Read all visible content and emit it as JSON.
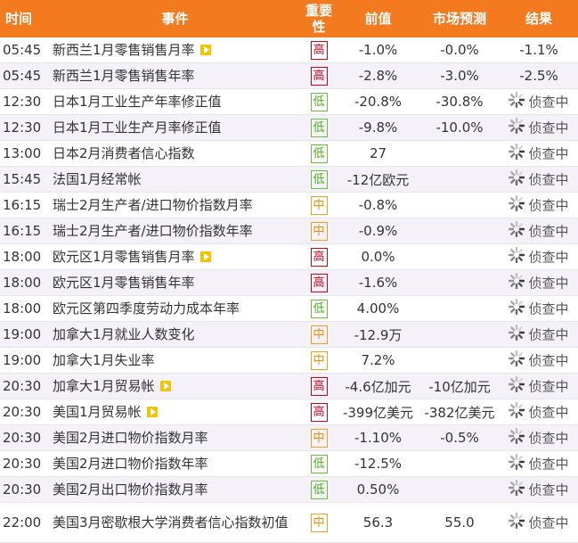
{
  "header": {
    "time": "时间",
    "event": "事件",
    "importance": "重要性",
    "previous": "前值",
    "forecast": "市场预测",
    "result": "结果"
  },
  "rows": [
    {
      "time": "05:45",
      "event": "新西兰1月零售销售月率",
      "video": true,
      "importance": "高",
      "level": "high",
      "previous": "-1.0%",
      "forecast": "-0.0%",
      "result": "-1.1%",
      "pending": false
    },
    {
      "time": "05:45",
      "event": "新西兰1月零售销售年率",
      "video": false,
      "importance": "高",
      "level": "high",
      "previous": "-2.8%",
      "forecast": "-3.0%",
      "result": "-2.5%",
      "pending": false
    },
    {
      "time": "12:30",
      "event": "日本1月工业生产年率修正值",
      "video": false,
      "importance": "低",
      "level": "low",
      "previous": "-20.8%",
      "forecast": "-30.8%",
      "result": "侦查中",
      "pending": true
    },
    {
      "time": "12:30",
      "event": "日本1月工业生产月率修正值",
      "video": false,
      "importance": "低",
      "level": "low",
      "previous": "-9.8%",
      "forecast": "-10.0%",
      "result": "侦查中",
      "pending": true
    },
    {
      "time": "13:00",
      "event": "日本2月消费者信心指数",
      "video": false,
      "importance": "低",
      "level": "low",
      "previous": "27",
      "forecast": "",
      "result": "侦查中",
      "pending": true
    },
    {
      "time": "15:45",
      "event": "法国1月经常帐",
      "video": false,
      "importance": "低",
      "level": "low",
      "previous": "-12亿欧元",
      "forecast": "",
      "result": "侦查中",
      "pending": true
    },
    {
      "time": "16:15",
      "event": "瑞士2月生产者/进口物价指数月率",
      "video": false,
      "importance": "中",
      "level": "mid",
      "previous": "-0.8%",
      "forecast": "",
      "result": "侦查中",
      "pending": true
    },
    {
      "time": "16:15",
      "event": "瑞士2月生产者/进口物价指数年率",
      "video": false,
      "importance": "中",
      "level": "mid",
      "previous": "-0.9%",
      "forecast": "",
      "result": "侦查中",
      "pending": true
    },
    {
      "time": "18:00",
      "event": "欧元区1月零售销售月率",
      "video": true,
      "importance": "高",
      "level": "high",
      "previous": "0.0%",
      "forecast": "",
      "result": "侦查中",
      "pending": true
    },
    {
      "time": "18:00",
      "event": "欧元区1月零售销售年率",
      "video": false,
      "importance": "高",
      "level": "high",
      "previous": "-1.6%",
      "forecast": "",
      "result": "侦查中",
      "pending": true
    },
    {
      "time": "18:00",
      "event": "欧元区第四季度劳动力成本年率",
      "video": false,
      "importance": "低",
      "level": "low",
      "previous": "4.00%",
      "forecast": "",
      "result": "侦查中",
      "pending": true
    },
    {
      "time": "19:00",
      "event": "加拿大1月就业人数变化",
      "video": false,
      "importance": "中",
      "level": "mid",
      "previous": "-12.9万",
      "forecast": "",
      "result": "侦查中",
      "pending": true
    },
    {
      "time": "19:00",
      "event": "加拿大1月失业率",
      "video": false,
      "importance": "中",
      "level": "mid",
      "previous": "7.2%",
      "forecast": "",
      "result": "侦查中",
      "pending": true
    },
    {
      "time": "20:30",
      "event": "加拿大1月贸易帐",
      "video": true,
      "importance": "高",
      "level": "high",
      "previous": "-4.6亿加元",
      "forecast": "-10亿加元",
      "result": "侦查中",
      "pending": true
    },
    {
      "time": "20:30",
      "event": "美国1月贸易帐",
      "video": true,
      "importance": "高",
      "level": "high",
      "previous": "-399亿美元",
      "forecast": "-382亿美元",
      "result": "侦查中",
      "pending": true
    },
    {
      "time": "20:30",
      "event": "美国2月进口物价指数月率",
      "video": false,
      "importance": "中",
      "level": "mid",
      "previous": "-1.10%",
      "forecast": "-0.5%",
      "result": "侦查中",
      "pending": true
    },
    {
      "time": "20:30",
      "event": "美国2月进口物价指数年率",
      "video": false,
      "importance": "低",
      "level": "low",
      "previous": "-12.5%",
      "forecast": "",
      "result": "侦查中",
      "pending": true
    },
    {
      "time": "20:30",
      "event": "美国2月出口物价指数月率",
      "video": false,
      "importance": "低",
      "level": "low",
      "previous": "0.50%",
      "forecast": "",
      "result": "侦查中",
      "pending": true
    },
    {
      "time": "22:00",
      "event": "美国3月密歇根大学消费者信心指数初值",
      "video": false,
      "importance": "中",
      "level": "mid",
      "previous": "56.3",
      "forecast": "55.0",
      "result": "侦查中",
      "pending": true
    }
  ],
  "colors": {
    "header_bg": "#f47a20",
    "high": "#d0021b",
    "mid": "#f08c00",
    "low": "#4caf1a",
    "video_icon": "#f5c400",
    "alt_row": "#f4f1f9"
  }
}
